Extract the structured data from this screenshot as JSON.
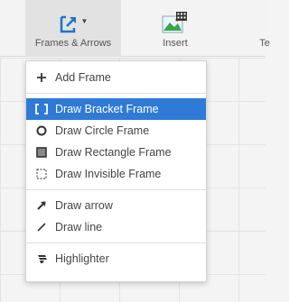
{
  "ribbon": {
    "frames_label": "Frames & Arrows",
    "insert_label": "Insert",
    "next_label": "Te"
  },
  "menu": {
    "add_frame": "Add Frame",
    "frame_items": [
      {
        "label": "Draw Bracket Frame",
        "selected": true
      },
      {
        "label": "Draw Circle Frame",
        "selected": false
      },
      {
        "label": "Draw Rectangle Frame",
        "selected": false
      },
      {
        "label": "Draw Invisible Frame",
        "selected": false
      }
    ],
    "draw_items": [
      {
        "label": "Draw arrow"
      },
      {
        "label": "Draw line"
      }
    ],
    "highlighter": "Highlighter"
  },
  "colors": {
    "selection": "#2f7ad6",
    "frames_icon_blue": "#1f73c9"
  }
}
